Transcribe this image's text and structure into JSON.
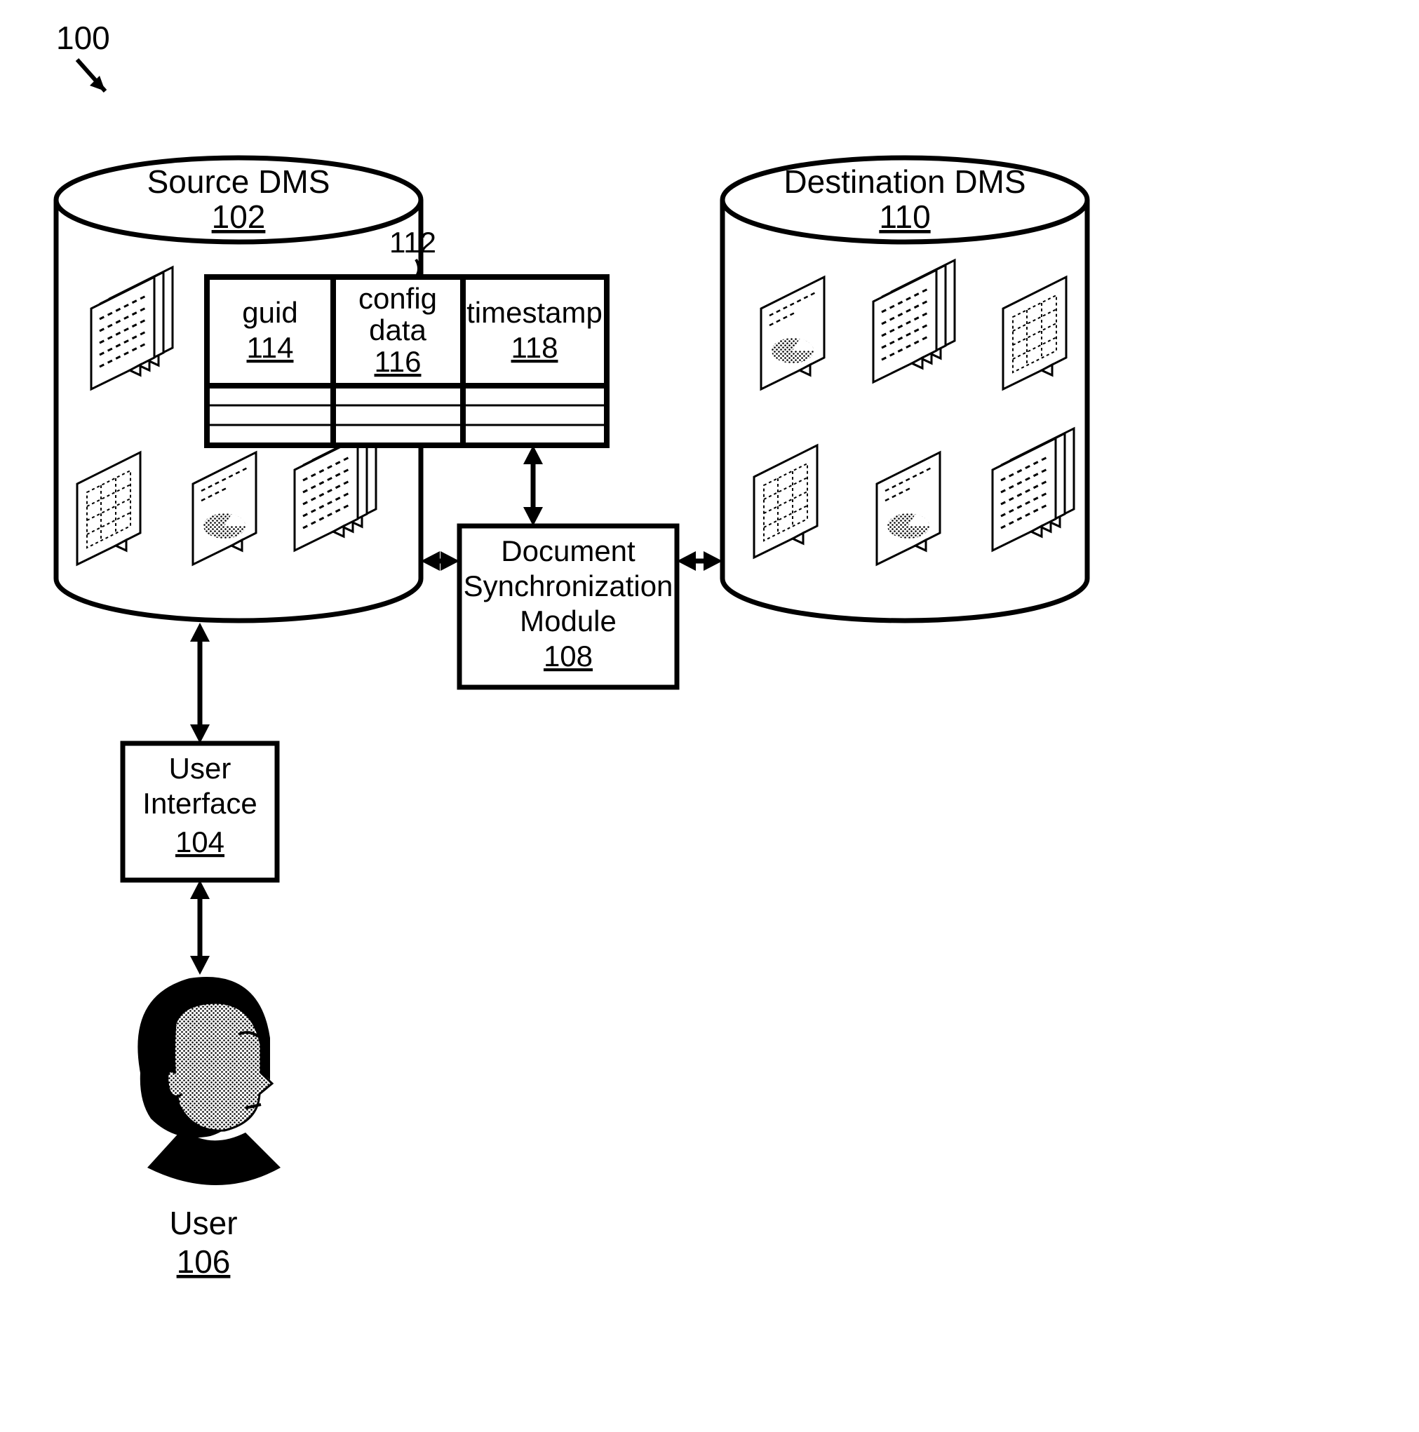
{
  "figure_ref": "100",
  "source_dms": {
    "title": "Source DMS",
    "ref": "102"
  },
  "destination_dms": {
    "title": "Destination DMS",
    "ref": "110"
  },
  "table": {
    "ref": "112",
    "cols": [
      {
        "title": "guid",
        "ref": "114"
      },
      {
        "title_line1": "config",
        "title_line2": "data",
        "ref": "116"
      },
      {
        "title": "timestamp",
        "ref": "118"
      }
    ]
  },
  "sync_module": {
    "line1": "Document",
    "line2": "Synchronization",
    "line3": "Module",
    "ref": "108"
  },
  "user_interface": {
    "line1": "User",
    "line2": "Interface",
    "ref": "104"
  },
  "user": {
    "title": "User",
    "ref": "106"
  }
}
